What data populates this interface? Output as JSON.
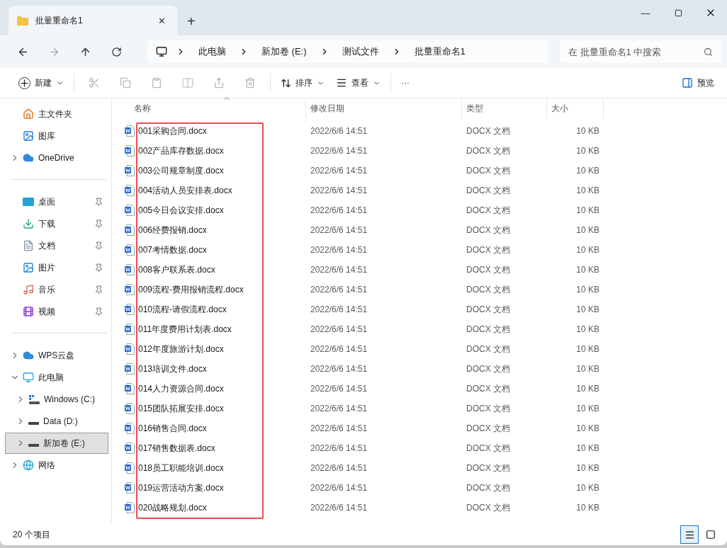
{
  "tab": {
    "title": "批量重命名1",
    "close": "✕",
    "new": "+"
  },
  "window_controls": {
    "minimize": "—"
  },
  "breadcrumb": [
    "此电脑",
    "新加卷 (E:)",
    "测试文件",
    "批量重命名1"
  ],
  "search": {
    "placeholder": "在 批量重命名1 中搜索"
  },
  "toolbar": {
    "new": "新建",
    "sort": "排序",
    "view": "查看",
    "more": "···",
    "preview": "预览"
  },
  "sidebar": [
    [
      {
        "label": "主文件夹",
        "kind": "home",
        "selected": false
      },
      {
        "label": "图库",
        "kind": "gallery",
        "selected": false
      },
      {
        "label": "OneDrive",
        "kind": "cloud",
        "expanded": false,
        "selected": false
      }
    ],
    [
      {
        "label": "桌面",
        "kind": "desktop",
        "pinned": true,
        "selected": false
      },
      {
        "label": "下载",
        "kind": "download",
        "pinned": true,
        "selected": false
      },
      {
        "label": "文档",
        "kind": "document",
        "pinned": true,
        "selected": false
      },
      {
        "label": "图片",
        "kind": "picture",
        "pinned": true,
        "selected": false
      },
      {
        "label": "音乐",
        "kind": "music",
        "pinned": true,
        "selected": false
      },
      {
        "label": "视频",
        "kind": "video",
        "pinned": true,
        "selected": false
      }
    ],
    [
      {
        "label": "WPS云盘",
        "kind": "cloud",
        "expanded": false,
        "selected": false
      },
      {
        "label": "此电脑",
        "kind": "computer",
        "expanded": true,
        "selected": false,
        "children": [
          {
            "label": "Windows (C:)",
            "kind": "windrive",
            "expanded": false,
            "selected": false
          },
          {
            "label": "Data (D:)",
            "kind": "drive",
            "expanded": false,
            "selected": false
          },
          {
            "label": "新加卷 (E:)",
            "kind": "drive",
            "expanded": false,
            "selected": true
          }
        ]
      },
      {
        "label": "网络",
        "kind": "network",
        "expanded": false,
        "selected": false
      }
    ]
  ],
  "table": {
    "columns": [
      "名称",
      "修改日期",
      "类型",
      "大小"
    ],
    "name_column_highlighted": true,
    "rows": [
      {
        "name": "001采购合同.docx",
        "date": "2022/6/6 14:51",
        "type": "DOCX 文档",
        "size": "10 KB"
      },
      {
        "name": "002产品库存数据.docx",
        "date": "2022/6/6 14:51",
        "type": "DOCX 文档",
        "size": "10 KB"
      },
      {
        "name": "003公司规章制度.docx",
        "date": "2022/6/6 14:51",
        "type": "DOCX 文档",
        "size": "10 KB"
      },
      {
        "name": "004活动人员安排表.docx",
        "date": "2022/6/6 14:51",
        "type": "DOCX 文档",
        "size": "10 KB"
      },
      {
        "name": "005今日会议安排.docx",
        "date": "2022/6/6 14:51",
        "type": "DOCX 文档",
        "size": "10 KB"
      },
      {
        "name": "006经费报销.docx",
        "date": "2022/6/6 14:51",
        "type": "DOCX 文档",
        "size": "10 KB"
      },
      {
        "name": "007考情数据.docx",
        "date": "2022/6/6 14:51",
        "type": "DOCX 文档",
        "size": "10 KB"
      },
      {
        "name": "008客户联系表.docx",
        "date": "2022/6/6 14:51",
        "type": "DOCX 文档",
        "size": "10 KB"
      },
      {
        "name": "009流程-费用报销流程.docx",
        "date": "2022/6/6 14:51",
        "type": "DOCX 文档",
        "size": "10 KB"
      },
      {
        "name": "010流程-请假流程.docx",
        "date": "2022/6/6 14:51",
        "type": "DOCX 文档",
        "size": "10 KB"
      },
      {
        "name": "011年度费用计划表.docx",
        "date": "2022/6/6 14:51",
        "type": "DOCX 文档",
        "size": "10 KB"
      },
      {
        "name": "012年度旅游计划.docx",
        "date": "2022/6/6 14:51",
        "type": "DOCX 文档",
        "size": "10 KB"
      },
      {
        "name": "013培训文件.docx",
        "date": "2022/6/6 14:51",
        "type": "DOCX 文档",
        "size": "10 KB"
      },
      {
        "name": "014人力资源合同.docx",
        "date": "2022/6/6 14:51",
        "type": "DOCX 文档",
        "size": "10 KB"
      },
      {
        "name": "015团队拓展安排.docx",
        "date": "2022/6/6 14:51",
        "type": "DOCX 文档",
        "size": "10 KB"
      },
      {
        "name": "016销售合同.docx",
        "date": "2022/6/6 14:51",
        "type": "DOCX 文档",
        "size": "10 KB"
      },
      {
        "name": "017销售数据表.docx",
        "date": "2022/6/6 14:51",
        "type": "DOCX 文档",
        "size": "10 KB"
      },
      {
        "name": "018员工职能培训.docx",
        "date": "2022/6/6 14:51",
        "type": "DOCX 文档",
        "size": "10 KB"
      },
      {
        "name": "019运营活动方案.docx",
        "date": "2022/6/6 14:51",
        "type": "DOCX 文档",
        "size": "10 KB"
      },
      {
        "name": "020战略规划.docx",
        "date": "2022/6/6 14:51",
        "type": "DOCX 文档",
        "size": "10 KB"
      }
    ]
  },
  "status_bar": {
    "count": "20 个项目",
    "views": [
      {
        "kind": "details",
        "selected": true
      },
      {
        "kind": "tiles",
        "selected": false
      }
    ]
  }
}
